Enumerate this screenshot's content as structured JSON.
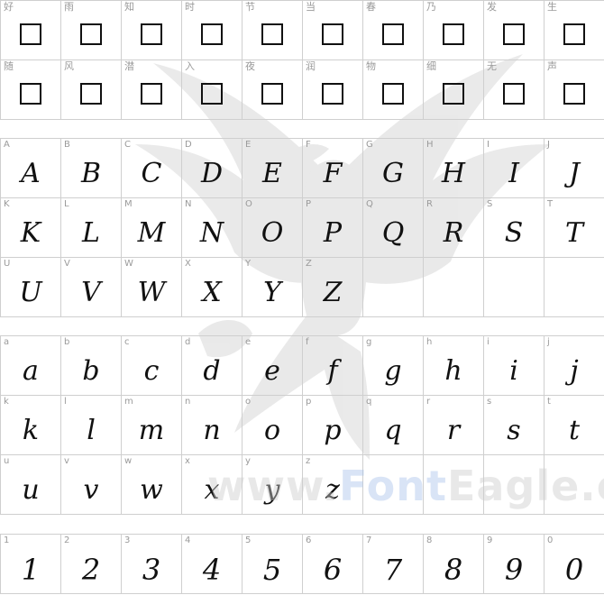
{
  "watermark": {
    "brand_prefix": "www.",
    "brand_accent": "Font",
    "brand_suffix": "Eagle.com"
  },
  "cjk_rows": [
    [
      "好",
      "雨",
      "知",
      "时",
      "节",
      "当",
      "春",
      "乃",
      "发",
      "生"
    ],
    [
      "随",
      "风",
      "潜",
      "入",
      "夜",
      "润",
      "物",
      "细",
      "无",
      "声"
    ]
  ],
  "upper_rows": [
    [
      "A",
      "B",
      "C",
      "D",
      "E",
      "F",
      "G",
      "H",
      "I",
      "J"
    ],
    [
      "K",
      "L",
      "M",
      "N",
      "O",
      "P",
      "Q",
      "R",
      "S",
      "T"
    ],
    [
      "U",
      "V",
      "W",
      "X",
      "Y",
      "Z"
    ]
  ],
  "lower_rows": [
    [
      "a",
      "b",
      "c",
      "d",
      "e",
      "f",
      "g",
      "h",
      "i",
      "j"
    ],
    [
      "k",
      "l",
      "m",
      "n",
      "o",
      "p",
      "q",
      "r",
      "s",
      "t"
    ],
    [
      "u",
      "v",
      "w",
      "x",
      "y",
      "z"
    ]
  ],
  "digit_rows": [
    [
      "1",
      "2",
      "3",
      "4",
      "5",
      "6",
      "7",
      "8",
      "9",
      "0"
    ]
  ]
}
